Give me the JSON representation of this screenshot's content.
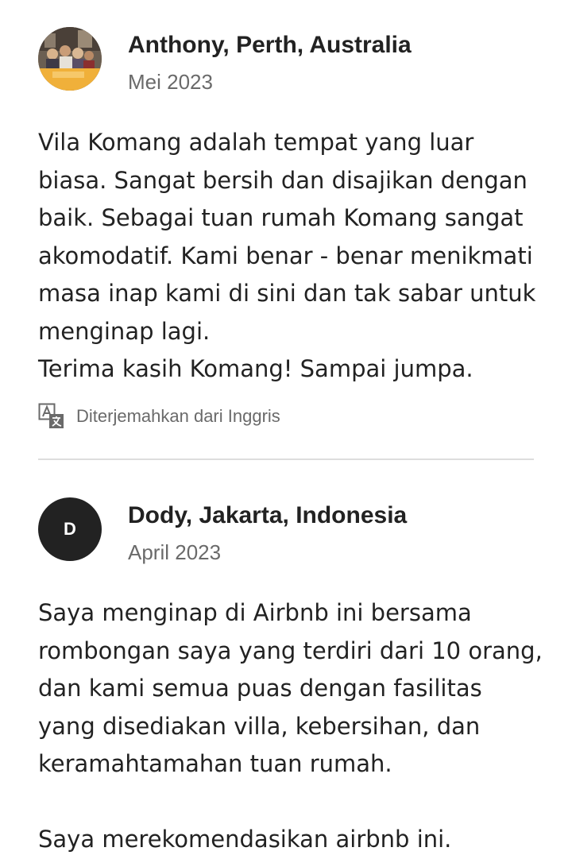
{
  "reviews": [
    {
      "reviewer": "Anthony, Perth, Australia",
      "date": "Mei 2023",
      "avatar_icon": "reviewer-photo",
      "body_lines": [
        "Vila Komang adalah tempat yang luar",
        "biasa. Sangat bersih dan disajikan dengan",
        "baik. Sebagai tuan rumah Komang sangat",
        "akomodatif. Kami benar - benar menikmati",
        "masa inap kami di sini dan tak sabar untuk",
        "menginap lagi.",
        "Terima kasih Komang! Sampai jumpa."
      ],
      "translation_note": "Diterjemahkan dari Inggris",
      "translation_icon": "translate-icon"
    },
    {
      "reviewer": "Dody, Jakarta, Indonesia",
      "date": "April 2023",
      "avatar_letter": "D",
      "body_lines": [
        "Saya menginap di Airbnb ini bersama",
        "rombongan saya yang terdiri dari 10 orang,",
        "dan kami semua puas dengan fasilitas",
        "yang disediakan villa, kebersihan, dan",
        "keramahtamahan tuan rumah.",
        "",
        "Saya merekomendasikan airbnb ini."
      ]
    }
  ],
  "colors": {
    "text_primary": "#222222",
    "text_secondary": "#6a6a6a",
    "divider": "#dddddd",
    "avatar_dark": "#222222"
  }
}
